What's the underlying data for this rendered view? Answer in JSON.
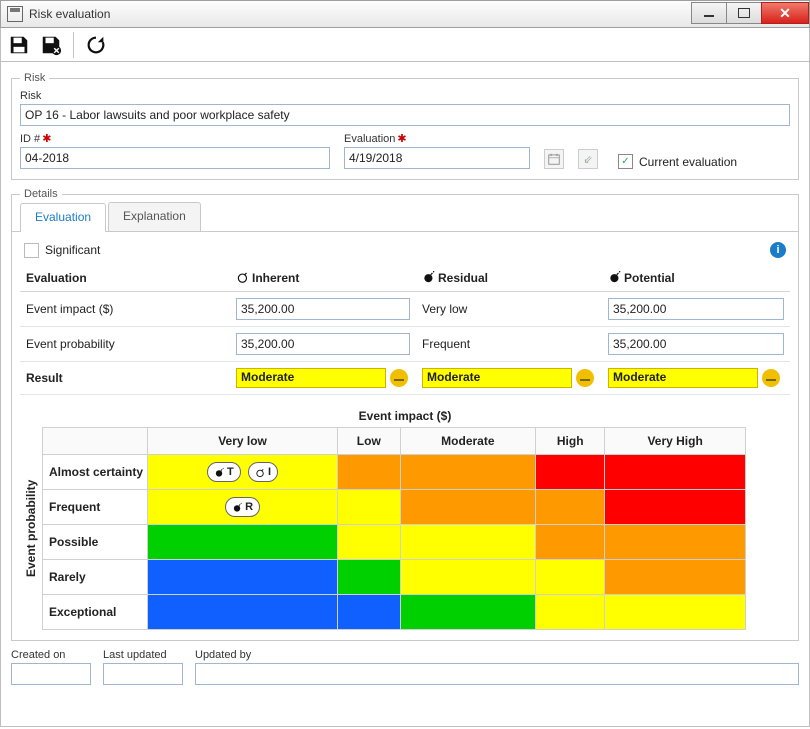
{
  "window": {
    "title": "Risk evaluation"
  },
  "toolbar": {
    "save": "Save",
    "saveClose": "Save and close",
    "refresh": "Refresh"
  },
  "riskGroup": {
    "legend": "Risk",
    "riskLabel": "Risk",
    "riskValue": "OP 16 - Labor lawsuits and poor workplace safety",
    "idLabel": "ID #",
    "idValue": "04-2018",
    "evalDateLabel": "Evaluation",
    "evalDateValue": "4/19/2018",
    "currentEvalLabel": "Current evaluation"
  },
  "details": {
    "legend": "Details",
    "tabs": {
      "evaluation": "Evaluation",
      "explanation": "Explanation"
    },
    "significantLabel": "Significant",
    "headers": {
      "evaluation": "Evaluation",
      "inherent": "Inherent",
      "residual": "Residual",
      "potential": "Potential"
    },
    "rows": {
      "impact": {
        "label": "Event impact ($)",
        "inherent": "35,200.00",
        "residual": "Very low",
        "potential": "35,200.00"
      },
      "prob": {
        "label": "Event probability",
        "inherent": "35,200.00",
        "residual": "Frequent",
        "potential": "35,200.00"
      },
      "result": {
        "label": "Result",
        "inherent": "Moderate",
        "residual": "Moderate",
        "potential": "Moderate"
      }
    }
  },
  "matrix": {
    "xTitle": "Event impact ($)",
    "yTitle": "Event probability",
    "cols": [
      "Very low",
      "Low",
      "Moderate",
      "High",
      "Very High"
    ],
    "rows": [
      "Almost certainty",
      "Frequent",
      "Possible",
      "Rarely",
      "Exceptional"
    ],
    "markers": {
      "T": "T",
      "I": "I",
      "R": "R"
    }
  },
  "footer": {
    "createdOn": "Created on",
    "lastUpdated": "Last updated",
    "updatedBy": "Updated by"
  }
}
